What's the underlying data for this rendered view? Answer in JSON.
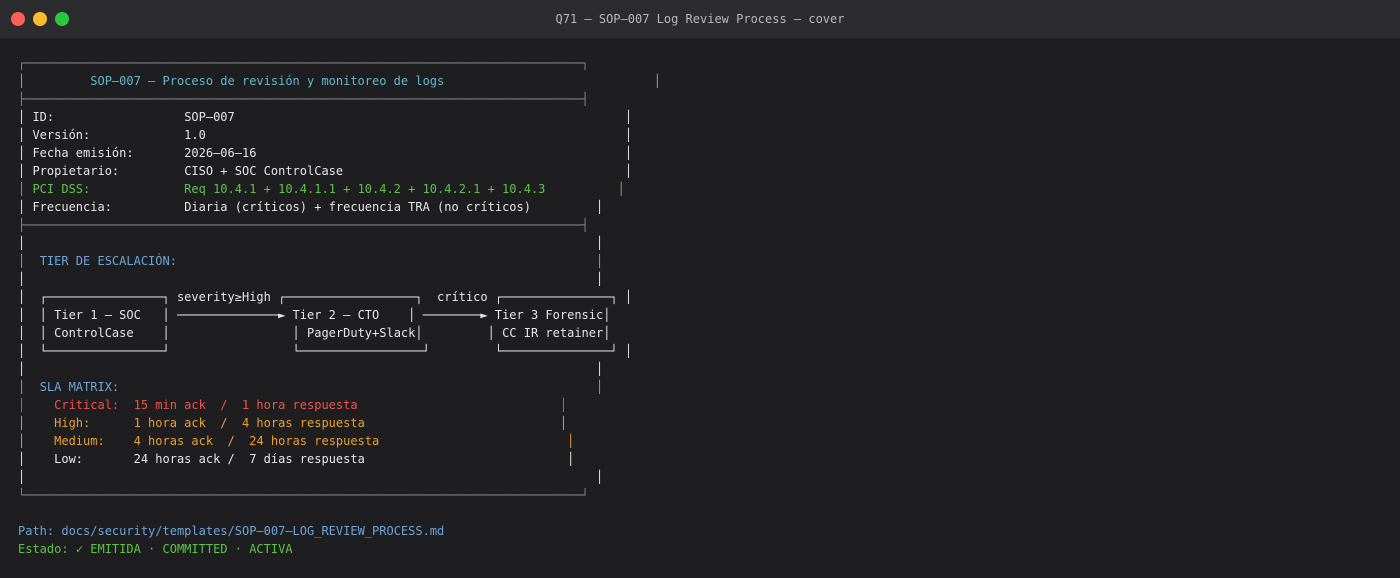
{
  "window": {
    "title": "Q71 — SOP–007 Log Review Process — cover"
  },
  "header": {
    "title": "SOP–007 — Proceso de revisión y monitoreo de logs"
  },
  "metadata": [
    {
      "label": "ID:",
      "value": "SOP–007"
    },
    {
      "label": "Versión:",
      "value": "1.0"
    },
    {
      "label": "Fecha emisión:",
      "value": "2026–06–16"
    },
    {
      "label": "Propietario:",
      "value": "CISO + SOC ControlCase"
    },
    {
      "label": "PCI DSS:",
      "value": "Req 10.4.1 + 10.4.1.1 + 10.4.2 + 10.4.2.1 + 10.4.3"
    },
    {
      "label": "Frecuencia:",
      "value": "Diaria (críticos) + frecuencia TRA (no críticos)"
    }
  ],
  "escalation": {
    "heading": "TIER DE ESCALACIÓN:",
    "tiers": [
      {
        "line1": "Tier 1 – SOC",
        "line2": "ControlCase"
      },
      {
        "line1": "Tier 2 – CTO",
        "line2": "PagerDuty+Slack"
      },
      {
        "line1": "Tier 3 Forensic",
        "line2": "CC IR retainer"
      }
    ],
    "arrows": [
      "severity≥High",
      "crítico"
    ]
  },
  "sla": {
    "heading": "SLA MATRIX:",
    "rows": [
      {
        "level": "Critical:",
        "ack": "15 min ack",
        "response": "1 hora respuesta",
        "color": "#ef5350"
      },
      {
        "level": "High:",
        "ack": "1 hora ack",
        "response": "4 horas respuesta",
        "color": "#e8a033"
      },
      {
        "level": "Medium:",
        "ack": "4 horas ack",
        "response": "24 horas respuesta",
        "color": "#e8a033"
      },
      {
        "level": "Low:",
        "ack": "24 horas ack",
        "response": "7 días respuesta",
        "color": "#e6e6e6"
      }
    ]
  },
  "footer": {
    "path_label": "Path:",
    "path": "docs/security/templates/SOP–007–LOG_REVIEW_PROCESS.md",
    "status_label": "Estado:",
    "status": "✓ EMITIDA · COMMITTED · ACTIVA"
  }
}
